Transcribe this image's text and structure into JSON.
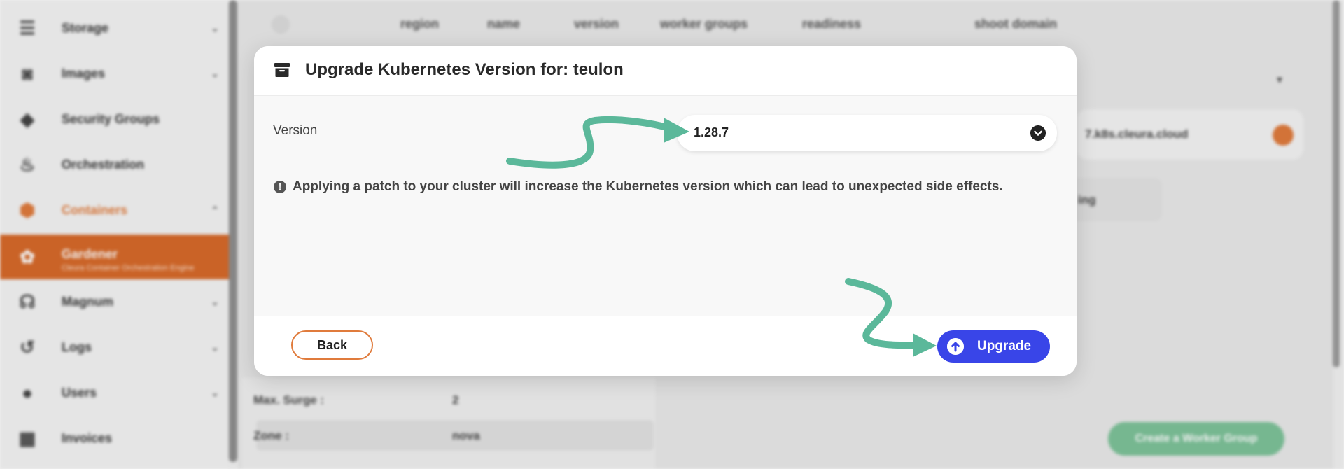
{
  "sidebar": {
    "items": [
      {
        "label": "Storage",
        "icon": "database-icon",
        "chevron": "⌄"
      },
      {
        "label": "Images",
        "icon": "camera-icon",
        "chevron": "⌄"
      },
      {
        "label": "Security Groups",
        "icon": "shield-icon",
        "chevron": ""
      },
      {
        "label": "Orchestration",
        "icon": "flame-icon",
        "chevron": ""
      },
      {
        "label": "Containers",
        "icon": "cube-icon",
        "chevron": "⌃"
      },
      {
        "label": "Gardener",
        "sublabel": "Cleura Container Orchestration Engine",
        "icon": "gardener-icon",
        "chevron": ""
      },
      {
        "label": "Magnum",
        "icon": "dragon-icon",
        "chevron": "⌄"
      },
      {
        "label": "Logs",
        "icon": "history-icon",
        "chevron": "⌄"
      },
      {
        "label": "Users",
        "icon": "user-icon",
        "chevron": "⌄"
      },
      {
        "label": "Invoices",
        "icon": "calculator-icon",
        "chevron": ""
      }
    ]
  },
  "table": {
    "headers": [
      "region",
      "name",
      "version",
      "worker groups",
      "readiness",
      "shoot domain"
    ]
  },
  "background": {
    "domain_text": "7.k8s.cleura.cloud",
    "tab_text": "ing",
    "rows": [
      {
        "label": "Max. Surge :",
        "value": "2"
      },
      {
        "label": "Zone :",
        "value": "nova"
      }
    ],
    "create_worker_group": "Create a Worker Group"
  },
  "modal": {
    "title": "Upgrade Kubernetes Version for: teulon",
    "version_label": "Version",
    "version_value": "1.28.7",
    "warning": "Applying a patch to your cluster will increase the Kubernetes version which can lead to unexpected side effects.",
    "back_label": "Back",
    "upgrade_label": "Upgrade"
  },
  "colors": {
    "accent_orange": "#e07b3c",
    "upgrade_blue": "#3945e8",
    "arrow_teal": "#5bb89a",
    "create_green": "#7ec39a"
  }
}
